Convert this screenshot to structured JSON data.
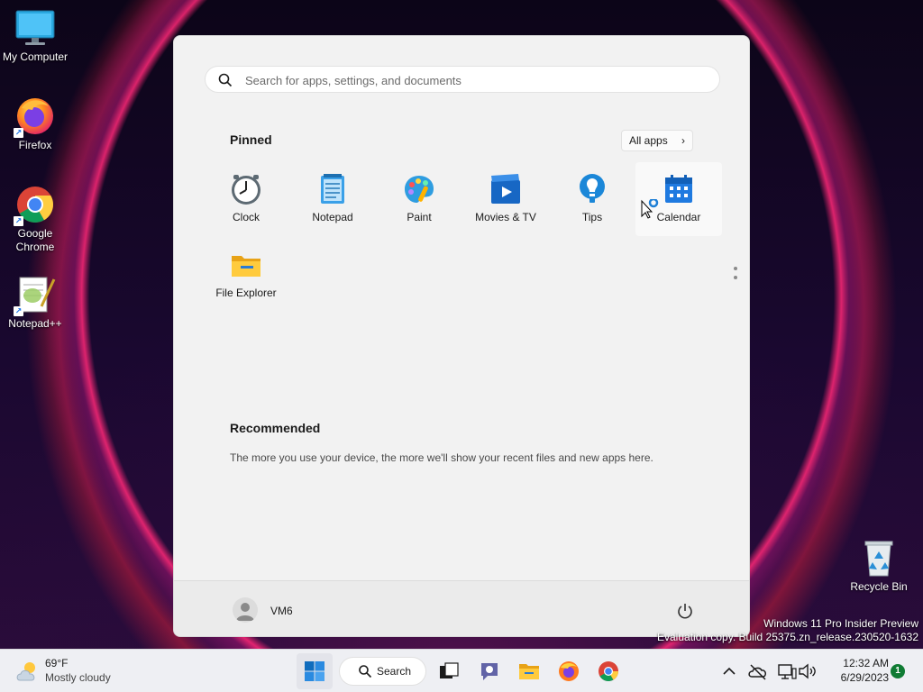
{
  "desktop": {
    "icons": [
      {
        "label": "My Computer"
      },
      {
        "label": "Firefox"
      },
      {
        "label": "Google Chrome"
      },
      {
        "label": "Notepad++"
      },
      {
        "label": "Recycle Bin"
      }
    ]
  },
  "start_menu": {
    "search_placeholder": "Search for apps, settings, and documents",
    "pinned_title": "Pinned",
    "all_apps_label": "All apps",
    "pinned_apps": [
      {
        "label": "Clock",
        "icon": "clock-icon"
      },
      {
        "label": "Notepad",
        "icon": "notepad-icon"
      },
      {
        "label": "Paint",
        "icon": "paint-icon"
      },
      {
        "label": "Movies & TV",
        "icon": "movies-icon"
      },
      {
        "label": "Tips",
        "icon": "tips-icon"
      },
      {
        "label": "Calendar",
        "icon": "calendar-icon"
      },
      {
        "label": "File Explorer",
        "icon": "folder-icon"
      }
    ],
    "recommended_title": "Recommended",
    "recommended_text": "The more you use your device, the more we'll show your recent files and new apps here.",
    "user_name": "VM6"
  },
  "watermark": {
    "line1": "Windows 11 Pro Insider Preview",
    "line2": "Evaluation copy. Build 25375.zn_release.230520-1632"
  },
  "taskbar": {
    "weather_temp": "69°F",
    "weather_desc": "Mostly cloudy",
    "search_label": "Search",
    "time": "12:32 AM",
    "date": "6/29/2023",
    "notification_count": "1"
  },
  "colors": {
    "accent": "#0067c0",
    "start_bg": "#f2f2f2",
    "taskbar_bg": "#eeeff3"
  }
}
